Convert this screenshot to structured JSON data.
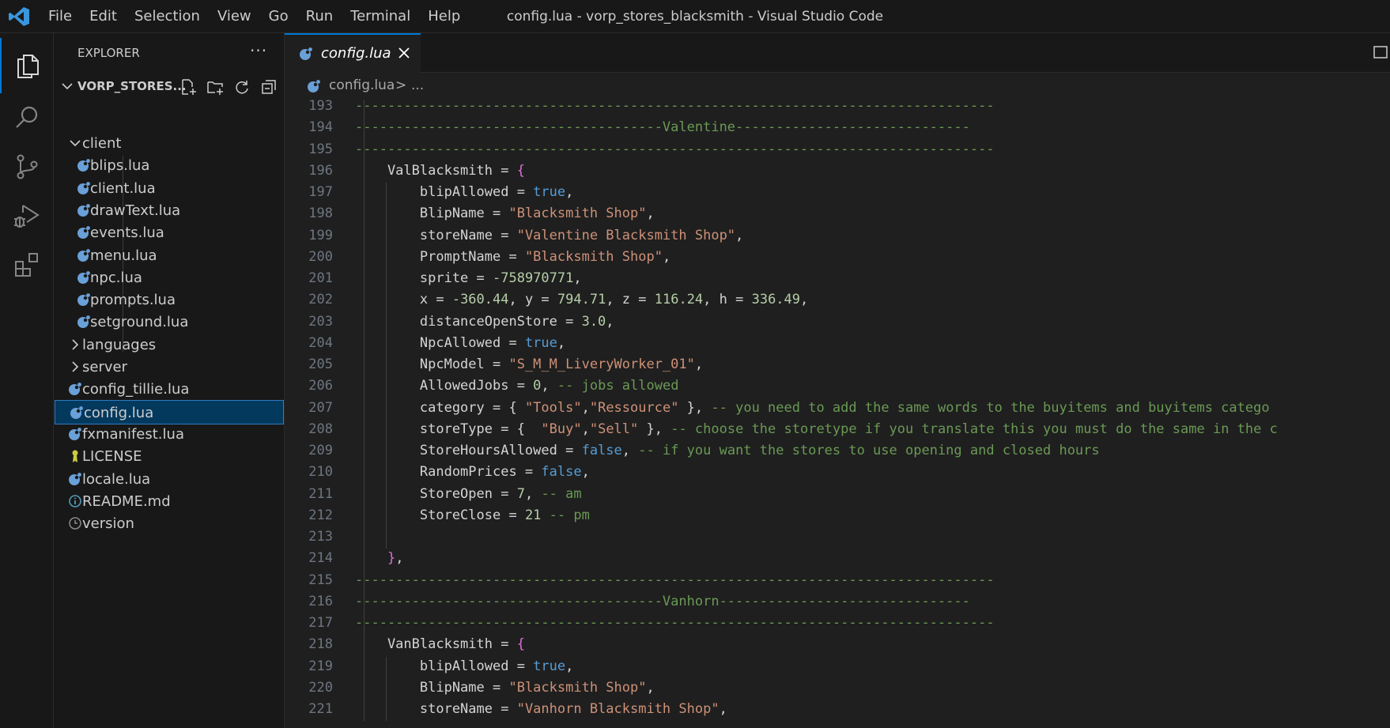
{
  "app": {
    "menu": [
      "File",
      "Edit",
      "Selection",
      "View",
      "Go",
      "Run",
      "Terminal",
      "Help"
    ],
    "window_title": "config.lua - vorp_stores_blacksmith - Visual Studio Code"
  },
  "colors": {
    "accent": "#0078d4",
    "background": "#1f1f1f",
    "sidebar_bg": "#181818",
    "selection": "#04395e",
    "comment": "#6a9955",
    "string": "#ce9178",
    "keyword": "#569cd6",
    "number": "#b5cea8"
  },
  "activity_bar": {
    "icons": [
      "files-icon",
      "search-icon",
      "source-control-icon",
      "run-debug-icon",
      "extensions-icon"
    ]
  },
  "explorer": {
    "title": "EXPLORER",
    "more": "···",
    "folder_name": "VORP_STORES...",
    "folder_actions": [
      "new-file-icon",
      "new-folder-icon",
      "refresh-icon",
      "collapse-all-icon"
    ],
    "items": [
      {
        "label": "client",
        "kind": "folder-open",
        "indent": 1
      },
      {
        "label": "blips.lua",
        "kind": "lua",
        "indent": 2
      },
      {
        "label": "client.lua",
        "kind": "lua",
        "indent": 2
      },
      {
        "label": "drawText.lua",
        "kind": "lua",
        "indent": 2
      },
      {
        "label": "events.lua",
        "kind": "lua",
        "indent": 2
      },
      {
        "label": "menu.lua",
        "kind": "lua",
        "indent": 2
      },
      {
        "label": "npc.lua",
        "kind": "lua",
        "indent": 2
      },
      {
        "label": "prompts.lua",
        "kind": "lua",
        "indent": 2
      },
      {
        "label": "setground.lua",
        "kind": "lua",
        "indent": 2
      },
      {
        "label": "languages",
        "kind": "folder-closed",
        "indent": 1
      },
      {
        "label": "server",
        "kind": "folder-closed",
        "indent": 1
      },
      {
        "label": "config_tillie.lua",
        "kind": "lua",
        "indent": 1
      },
      {
        "label": "config.lua",
        "kind": "lua",
        "indent": 1,
        "selected": true
      },
      {
        "label": "fxmanifest.lua",
        "kind": "lua",
        "indent": 1
      },
      {
        "label": "LICENSE",
        "kind": "license",
        "indent": 1
      },
      {
        "label": "locale.lua",
        "kind": "lua",
        "indent": 1
      },
      {
        "label": "README.md",
        "kind": "info",
        "indent": 1
      },
      {
        "label": "version",
        "kind": "clock",
        "indent": 1
      }
    ]
  },
  "tab": {
    "label": "config.lua",
    "close": "×"
  },
  "breadcrumb": {
    "file": "config.lua",
    "separator": ">",
    "more": "..."
  },
  "code_lines": [
    {
      "n": "193",
      "indent": 1,
      "tokens": [
        [
          "comment",
          "-------------------------------------------------------------------------------"
        ]
      ]
    },
    {
      "n": "194",
      "indent": 1,
      "tokens": [
        [
          "comment",
          "--------------------------------------Valentine-----------------------------"
        ]
      ]
    },
    {
      "n": "195",
      "indent": 1,
      "tokens": [
        [
          "comment",
          "-------------------------------------------------------------------------------"
        ]
      ]
    },
    {
      "n": "196",
      "indent": 1,
      "tokens": [
        [
          "plain",
          "    ValBlacksmith = "
        ],
        [
          "brace",
          "{"
        ]
      ]
    },
    {
      "n": "197",
      "indent": 2,
      "tokens": [
        [
          "plain",
          "        blipAllowed = "
        ],
        [
          "kw",
          "true"
        ],
        [
          "plain",
          ","
        ]
      ]
    },
    {
      "n": "198",
      "indent": 2,
      "tokens": [
        [
          "plain",
          "        BlipName = "
        ],
        [
          "str",
          "\"Blacksmith Shop\""
        ],
        [
          "plain",
          ","
        ]
      ]
    },
    {
      "n": "199",
      "indent": 2,
      "tokens": [
        [
          "plain",
          "        storeName = "
        ],
        [
          "str",
          "\"Valentine Blacksmith Shop\""
        ],
        [
          "plain",
          ","
        ]
      ]
    },
    {
      "n": "200",
      "indent": 2,
      "tokens": [
        [
          "plain",
          "        PromptName = "
        ],
        [
          "str",
          "\"Blacksmith Shop\""
        ],
        [
          "plain",
          ","
        ]
      ]
    },
    {
      "n": "201",
      "indent": 2,
      "tokens": [
        [
          "plain",
          "        sprite = "
        ],
        [
          "num",
          "-758970771"
        ],
        [
          "plain",
          ","
        ]
      ]
    },
    {
      "n": "202",
      "indent": 2,
      "tokens": [
        [
          "plain",
          "        x = "
        ],
        [
          "num",
          "-360.44"
        ],
        [
          "plain",
          ", y = "
        ],
        [
          "num",
          "794.71"
        ],
        [
          "plain",
          ", z = "
        ],
        [
          "num",
          "116.24"
        ],
        [
          "plain",
          ", h = "
        ],
        [
          "num",
          "336.49"
        ],
        [
          "plain",
          ","
        ]
      ]
    },
    {
      "n": "203",
      "indent": 2,
      "tokens": [
        [
          "plain",
          "        distanceOpenStore = "
        ],
        [
          "num",
          "3.0"
        ],
        [
          "plain",
          ","
        ]
      ]
    },
    {
      "n": "204",
      "indent": 2,
      "tokens": [
        [
          "plain",
          "        NpcAllowed = "
        ],
        [
          "kw",
          "true"
        ],
        [
          "plain",
          ","
        ]
      ]
    },
    {
      "n": "205",
      "indent": 2,
      "tokens": [
        [
          "plain",
          "        NpcModel = "
        ],
        [
          "str",
          "\"S_M_M_LiveryWorker_01\""
        ],
        [
          "plain",
          ","
        ]
      ]
    },
    {
      "n": "206",
      "indent": 2,
      "tokens": [
        [
          "plain",
          "        AllowedJobs = "
        ],
        [
          "num",
          "0"
        ],
        [
          "plain",
          ", "
        ],
        [
          "comment",
          "-- jobs allowed"
        ]
      ]
    },
    {
      "n": "207",
      "indent": 2,
      "tokens": [
        [
          "plain",
          "        category = { "
        ],
        [
          "str",
          "\"Tools\""
        ],
        [
          "plain",
          ","
        ],
        [
          "str",
          "\"Ressource\""
        ],
        [
          "plain",
          " }, "
        ],
        [
          "comment",
          "-- you need to add the same words to the buyitems and buyitems catego"
        ]
      ]
    },
    {
      "n": "208",
      "indent": 2,
      "tokens": [
        [
          "plain",
          "        storeType = {  "
        ],
        [
          "str",
          "\"Buy\""
        ],
        [
          "plain",
          ","
        ],
        [
          "str",
          "\"Sell\""
        ],
        [
          "plain",
          " }, "
        ],
        [
          "comment",
          "-- choose the storetype if you translate this you must do the same in the c"
        ]
      ]
    },
    {
      "n": "209",
      "indent": 2,
      "tokens": [
        [
          "plain",
          "        StoreHoursAllowed = "
        ],
        [
          "kw",
          "false"
        ],
        [
          "plain",
          ", "
        ],
        [
          "comment",
          "-- if you want the stores to use opening and closed hours"
        ]
      ]
    },
    {
      "n": "210",
      "indent": 2,
      "tokens": [
        [
          "plain",
          "        RandomPrices = "
        ],
        [
          "kw",
          "false"
        ],
        [
          "plain",
          ","
        ]
      ]
    },
    {
      "n": "211",
      "indent": 2,
      "tokens": [
        [
          "plain",
          "        StoreOpen = "
        ],
        [
          "num",
          "7"
        ],
        [
          "plain",
          ", "
        ],
        [
          "comment",
          "-- am"
        ]
      ]
    },
    {
      "n": "212",
      "indent": 2,
      "tokens": [
        [
          "plain",
          "        StoreClose = "
        ],
        [
          "num",
          "21"
        ],
        [
          "plain",
          " "
        ],
        [
          "comment",
          "-- pm"
        ]
      ]
    },
    {
      "n": "213",
      "indent": 2,
      "tokens": []
    },
    {
      "n": "214",
      "indent": 1,
      "tokens": [
        [
          "plain",
          "    "
        ],
        [
          "brace",
          "}"
        ],
        [
          "plain",
          ","
        ]
      ]
    },
    {
      "n": "215",
      "indent": 1,
      "tokens": [
        [
          "comment",
          "-------------------------------------------------------------------------------"
        ]
      ]
    },
    {
      "n": "216",
      "indent": 1,
      "tokens": [
        [
          "comment",
          "--------------------------------------Vanhorn-------------------------------"
        ]
      ]
    },
    {
      "n": "217",
      "indent": 1,
      "tokens": [
        [
          "comment",
          "-------------------------------------------------------------------------------"
        ]
      ]
    },
    {
      "n": "218",
      "indent": 1,
      "tokens": [
        [
          "plain",
          "    VanBlacksmith = "
        ],
        [
          "brace",
          "{"
        ]
      ]
    },
    {
      "n": "219",
      "indent": 2,
      "tokens": [
        [
          "plain",
          "        blipAllowed = "
        ],
        [
          "kw",
          "true"
        ],
        [
          "plain",
          ","
        ]
      ]
    },
    {
      "n": "220",
      "indent": 2,
      "tokens": [
        [
          "plain",
          "        BlipName = "
        ],
        [
          "str",
          "\"Blacksmith Shop\""
        ],
        [
          "plain",
          ","
        ]
      ]
    },
    {
      "n": "221",
      "indent": 2,
      "tokens": [
        [
          "plain",
          "        storeName = "
        ],
        [
          "str",
          "\"Vanhorn Blacksmith Shop\""
        ],
        [
          "plain",
          ","
        ]
      ]
    }
  ]
}
